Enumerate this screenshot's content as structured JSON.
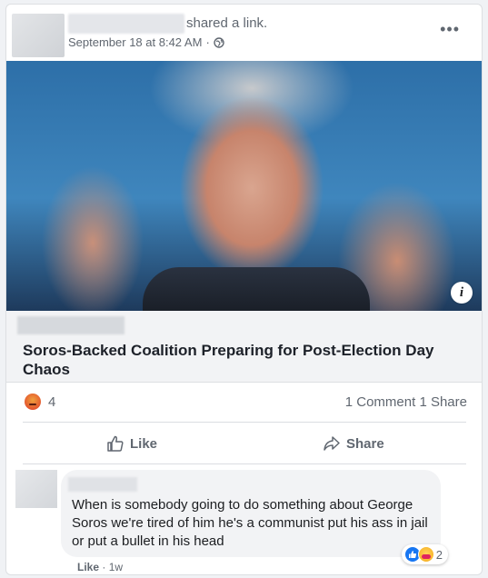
{
  "post": {
    "shared_text": "shared a link.",
    "timestamp": "September 18 at 8:42 AM",
    "separator": "·",
    "more_icon": "•••",
    "info_icon": "i"
  },
  "link": {
    "title": "Soros-Backed Coalition Preparing for Post-Election Day Chaos"
  },
  "stats": {
    "reaction_count": "4",
    "comments": "1 Comment",
    "shares": "1 Share"
  },
  "actions": {
    "like_label": "Like",
    "share_label": "Share"
  },
  "comment": {
    "text": "When is somebody going to do something about George Soros we're tired of him he's a communist put his ass in jail or put a bullet in his head",
    "reaction_count": "2",
    "like_link": "Like",
    "separator": "·",
    "age": "1w"
  },
  "colors": {
    "accent": "#1877f2",
    "muted_text": "#606770",
    "card_bg": "#ffffff",
    "link_meta_bg": "#f2f3f5"
  },
  "icons": [
    "more-options-icon",
    "globe-icon",
    "info-icon",
    "angry-reaction-icon",
    "thumbs-up-icon",
    "share-arrow-icon",
    "like-reaction-icon",
    "care-reaction-icon"
  ]
}
